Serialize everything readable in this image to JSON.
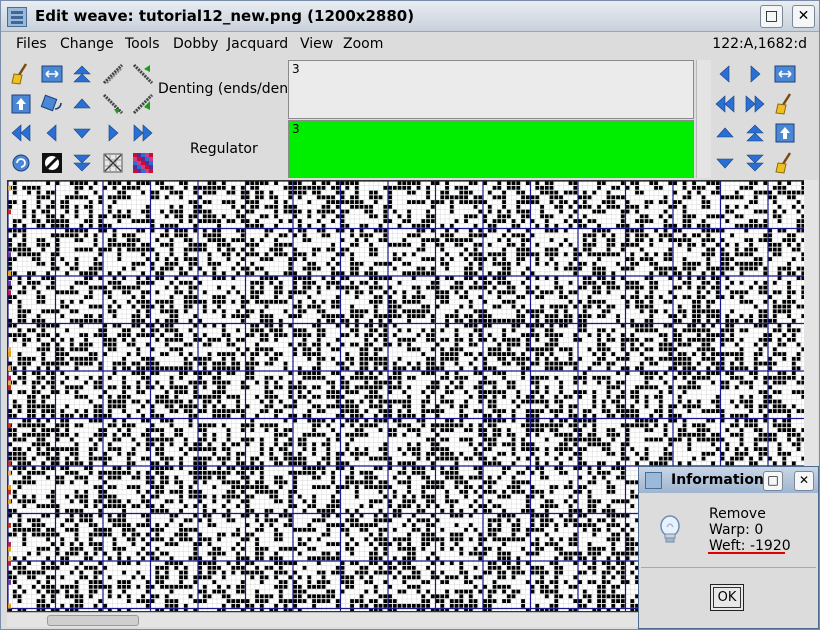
{
  "window": {
    "title": "Edit weave: tutorial12_new.png (1200x2880)",
    "maximize_glyph": "□",
    "close_glyph": "✕"
  },
  "menubar": {
    "items": [
      "Files",
      "Change",
      "Tools",
      "Dobby",
      "Jacquard",
      "View",
      "Zoom"
    ],
    "coords": "122:A,1682:d"
  },
  "toolbar": {
    "icons": [
      "broom-icon",
      "swap-horizontal-icon",
      "arrow-up-double-icon",
      "diagonal-up-icon",
      "diagonal-converge-icon",
      "lift-plan-icon",
      "rotate-shape-icon",
      "arrow-up-icon",
      "diagonal-down-icon",
      "diagonal-green-up-icon",
      "rewind-left-icon",
      "arrow-left-icon",
      "arrow-down-icon",
      "arrow-right-icon",
      "fast-forward-right-icon",
      "refresh-icon",
      "invert-icon",
      "arrow-down-double-icon",
      "clear-grid-icon",
      "color-pattern-icon"
    ],
    "right_icons": [
      "arrow-left-icon",
      "arrow-right-icon",
      "swap-horizontal-icon",
      "rewind-left-icon",
      "fast-forward-right-icon",
      "broom-icon",
      "arrow-up-icon",
      "arrow-up-double-icon",
      "lift-up-icon",
      "arrow-down-icon",
      "arrow-down-double-icon",
      "broom-icon"
    ]
  },
  "denting": {
    "label": "Denting (ends/dent)",
    "value": "3"
  },
  "regulator": {
    "label": "Regulator",
    "value": "3"
  },
  "colors": {
    "regulator_bg": "#00ee00",
    "grid_line": "#1a1a8a",
    "cell_on": "#000000",
    "cell_off": "#ffffff"
  },
  "dialog": {
    "title": "Information",
    "line1": "Remove",
    "line2": "Warp:  0",
    "line3": "Weft:  -1920",
    "ok_label": "OK",
    "max_glyph": "□",
    "close_glyph": "✕"
  }
}
